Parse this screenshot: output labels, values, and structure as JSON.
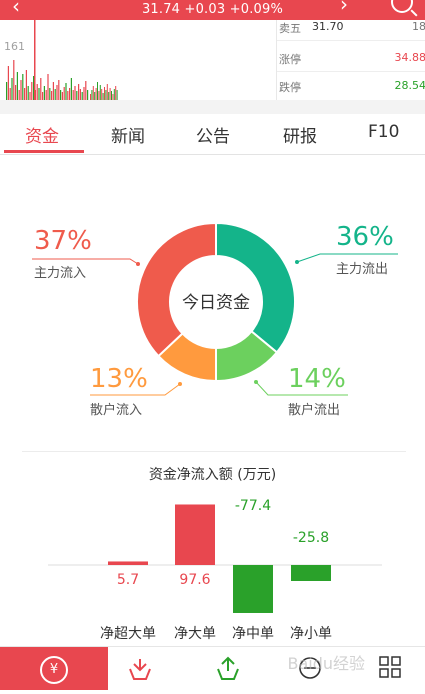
{
  "topbar": {
    "price_line": "31.74 +0.03 +0.09%"
  },
  "mini_chart": {
    "tick_label": "161"
  },
  "order_book": {
    "rows": [
      {
        "label": "卖五",
        "price": "31.70",
        "qty": "18"
      },
      {
        "label": "涨停",
        "value": "34.88",
        "color": "#e8474f"
      },
      {
        "label": "跌停",
        "value": "28.54",
        "color": "#2aa12a"
      }
    ]
  },
  "tabs": [
    {
      "label": "资金",
      "active": true
    },
    {
      "label": "新闻"
    },
    {
      "label": "公告"
    },
    {
      "label": "研报"
    },
    {
      "label": "F10"
    }
  ],
  "donut": {
    "center_label": "今日资金",
    "segments": [
      {
        "name": "主力流入",
        "percent": "37%",
        "value": 37,
        "color": "#ef5b4c"
      },
      {
        "name": "主力流出",
        "percent": "36%",
        "value": 36,
        "color": "#14b48a"
      },
      {
        "name": "散户流出",
        "percent": "14%",
        "value": 14,
        "color": "#6cd05e"
      },
      {
        "name": "散户流入",
        "percent": "13%",
        "value": 13,
        "color": "#ff9a3e"
      }
    ]
  },
  "flow": {
    "title": "资金净流入额 (万元)"
  },
  "chart_data": {
    "type": "bar",
    "title": "资金净流入额 (万元)",
    "categories": [
      "净超大单",
      "净大单",
      "净中单",
      "净小单"
    ],
    "values": [
      5.7,
      97.6,
      -77.4,
      -25.8
    ],
    "value_labels": [
      "5.7",
      "97.6",
      "-77.4",
      "-25.8"
    ],
    "colors": [
      "#e8474f",
      "#e8474f",
      "#2aa12a",
      "#2aa12a"
    ],
    "ylim": [
      -100,
      100
    ],
    "grid": false,
    "legend": "none"
  },
  "bottom_bar": {
    "items": [
      {
        "icon": "yen-circle-icon",
        "glyph": "¥",
        "active": true
      },
      {
        "icon": "download-arrow-icon"
      },
      {
        "icon": "upload-arrow-icon"
      },
      {
        "icon": "minus-circle-icon"
      },
      {
        "icon": "grid-icon"
      }
    ]
  },
  "watermark": "Baidu经验"
}
